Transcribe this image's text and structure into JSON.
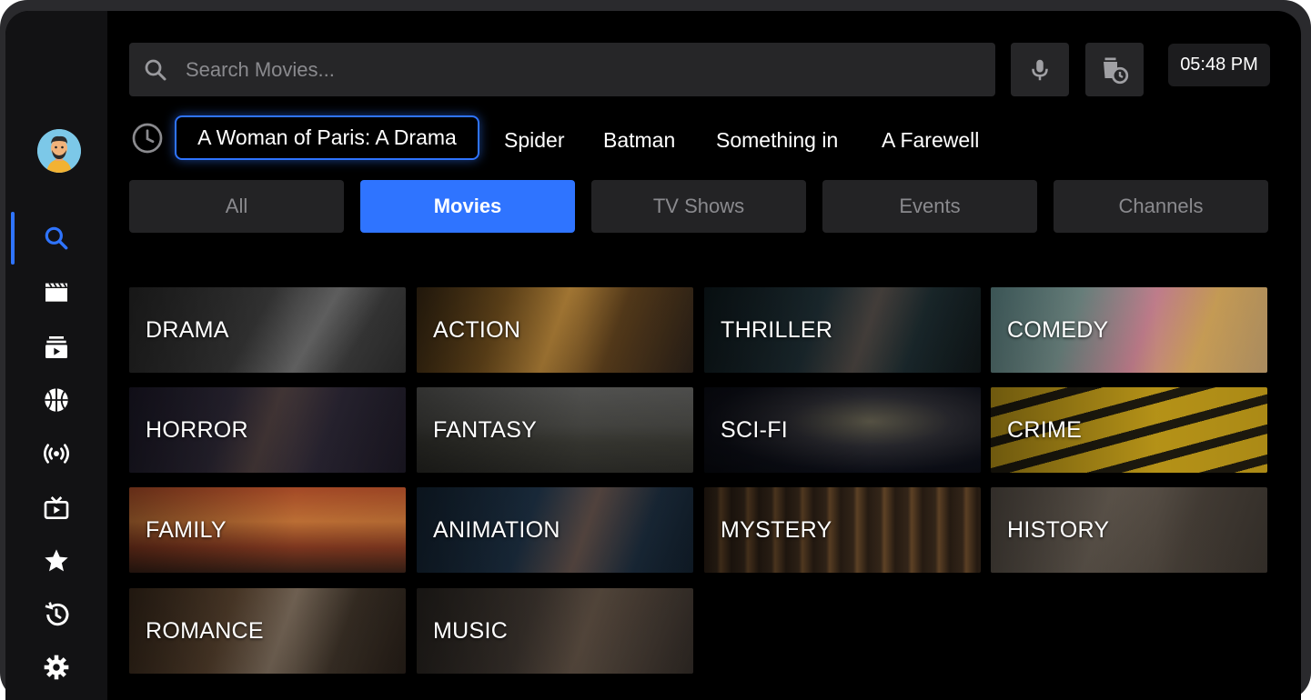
{
  "search": {
    "placeholder": "Search Movies..."
  },
  "time": "05:48 PM",
  "recent_searches": [
    "A Woman of Paris: A Drama",
    "Spider",
    "Batman",
    "Something in",
    "A Farewell"
  ],
  "tabs": [
    {
      "label": "All",
      "active": false
    },
    {
      "label": "Movies",
      "active": true
    },
    {
      "label": "TV Shows",
      "active": false
    },
    {
      "label": "Events",
      "active": false
    },
    {
      "label": "Channels",
      "active": false
    }
  ],
  "genres": [
    "DRAMA",
    "ACTION",
    "THRILLER",
    "COMEDY",
    "HORROR",
    "FANTASY",
    "SCI-FI",
    "CRIME",
    "FAMILY",
    "ANIMATION",
    "MYSTERY",
    "HISTORY",
    "ROMANCE",
    "MUSIC"
  ],
  "sidebar": {
    "items": [
      {
        "icon": "search-icon",
        "active": true
      },
      {
        "icon": "clapperboard-icon",
        "active": false
      },
      {
        "icon": "play-library-icon",
        "active": false
      },
      {
        "icon": "basketball-icon",
        "active": false
      },
      {
        "icon": "broadcast-icon",
        "active": false
      },
      {
        "icon": "tv-icon",
        "active": false
      },
      {
        "icon": "star-icon",
        "active": false
      },
      {
        "icon": "history-icon",
        "active": false
      },
      {
        "icon": "gear-icon",
        "active": false
      }
    ]
  },
  "colors": {
    "accent": "#2f74ff",
    "background": "#000000",
    "surface": "#262628"
  }
}
